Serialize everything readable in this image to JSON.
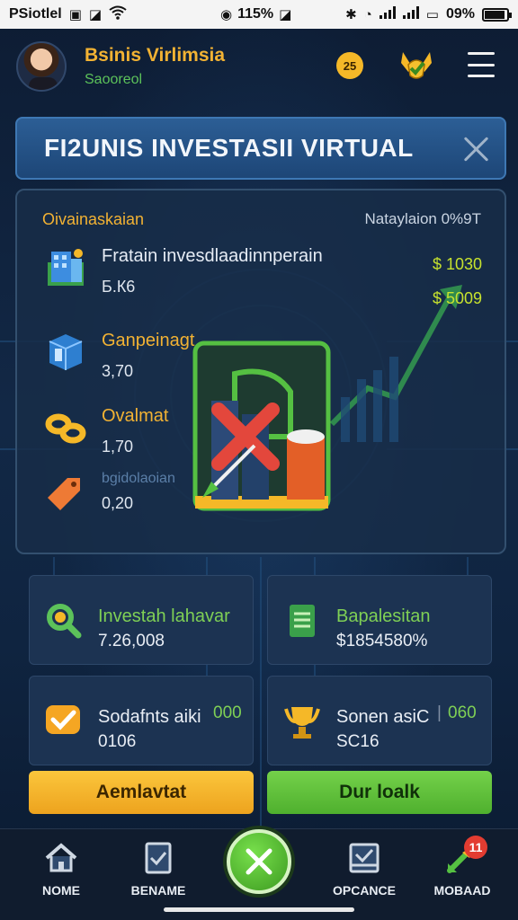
{
  "status_bar": {
    "carrier": "PSiotlel",
    "center_text": "115%",
    "battery_text": "09%",
    "battery_fraction": 0.9
  },
  "header": {
    "user_name": "Bsinis Virlimsia",
    "user_status": "Saooreol",
    "coin_count": "25"
  },
  "title_banner": {
    "title": "FI2UNIS INVESTASII VIRTUAL"
  },
  "panel": {
    "title": "Oivainaskaian",
    "meta": "Nataylaion 0%9T",
    "rows": [
      {
        "label": "Fratain invesdlaadinnperain",
        "value": "Б.К6",
        "label_color": "#e9eef5"
      },
      {
        "label": "Ganpeinagt",
        "value": "3,70",
        "label_color": "#f2b233"
      },
      {
        "label": "Ovalmat",
        "value": "1,70",
        "label_color": "#f2b233"
      },
      {
        "label": "bgidolaoian",
        "value": "0,20",
        "label_color": "#5b7fa8"
      }
    ],
    "stat_1": "$ 1030",
    "stat_2": "$ 5009"
  },
  "cards": [
    {
      "label": "Investah lahavar",
      "value": "7.26,008",
      "label_color": "#7fd055",
      "icon": "magnifier-icon"
    },
    {
      "label": "Bapalesitan",
      "value": "$1854580%",
      "label_color": "#7fd055",
      "icon": "document-icon"
    },
    {
      "label": "Sodafnts aiki",
      "value": "0106",
      "extra": "000",
      "label_color": "#e9eef5",
      "icon": "checkmark-badge-icon"
    },
    {
      "label": "Sonen asiC",
      "value": "SC16",
      "extra": "060",
      "label_color": "#e9eef5",
      "icon": "trophy-icon"
    }
  ],
  "buttons": {
    "primary": "Aemlavtat",
    "secondary": "Dur loalk"
  },
  "bottom_nav": {
    "items": [
      {
        "label": "NOME",
        "icon": "home-icon"
      },
      {
        "label": "BENAME",
        "icon": "clipboard-icon"
      },
      {
        "label": "OPCANCE",
        "icon": "inbox-check-icon"
      },
      {
        "label": "MOBAAD",
        "icon": "growth-arrow-icon"
      }
    ],
    "badge": "11"
  }
}
